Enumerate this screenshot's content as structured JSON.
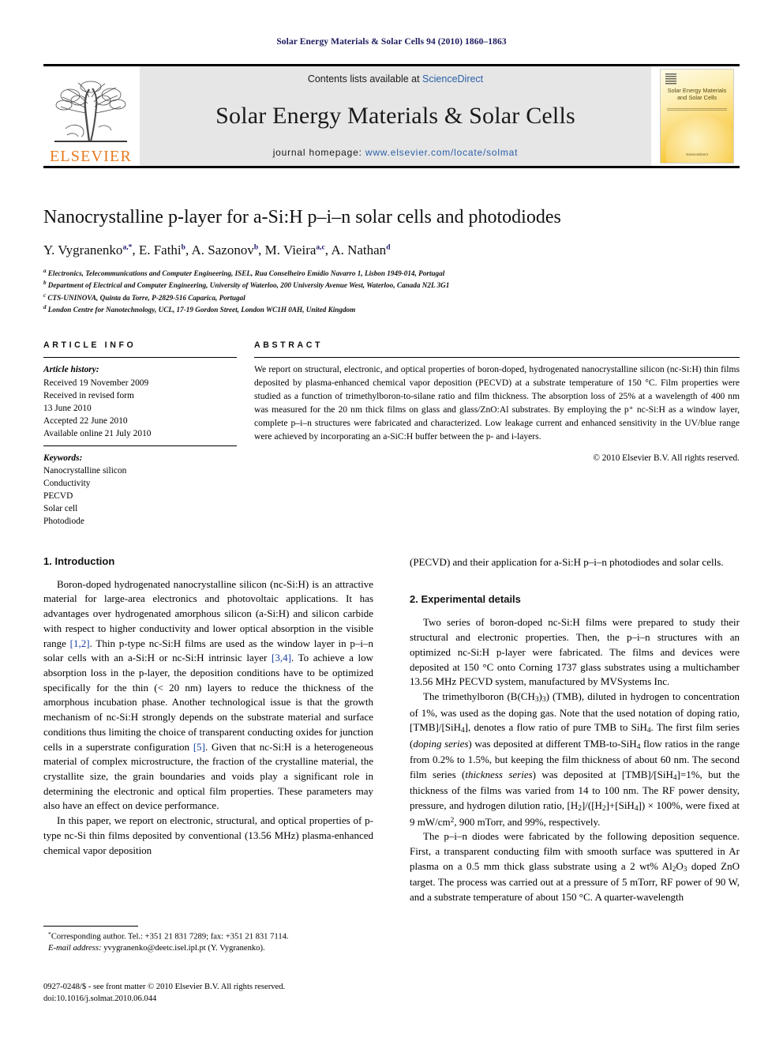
{
  "runhead": "Solar Energy Materials & Solar Cells 94 (2010) 1860–1863",
  "masthead": {
    "contents_prefix": "Contents lists available at ",
    "sciencedirect": "ScienceDirect",
    "journal_title": "Solar Energy Materials & Solar Cells",
    "homepage_prefix": "journal homepage: ",
    "homepage_url": "www.elsevier.com/locate/solmat",
    "publisher_logo_text": "ELSEVIER",
    "cover": {
      "line1": "Solar Energy Materials",
      "line2": "and Solar Cells",
      "footer": "ScienceDirect"
    },
    "link_color": "#2b5fa8",
    "band_bg": "#e6e6e6",
    "logo_color": "#E8791E"
  },
  "article": {
    "title": "Nanocrystalline p-layer for a-Si:H p–i–n solar cells and photodiodes",
    "authors": [
      {
        "name": "Y. Vygranenko",
        "marks": "a,*"
      },
      {
        "name": "E. Fathi",
        "marks": "b"
      },
      {
        "name": "A. Sazonov",
        "marks": "b"
      },
      {
        "name": "M. Vieira",
        "marks": "a,c"
      },
      {
        "name": "A. Nathan",
        "marks": "d"
      }
    ],
    "affiliations": [
      {
        "mark": "a",
        "text": "Electronics, Telecommunications and Computer Engineering, ISEL, Rua Conselheiro Emídio Navarro 1, Lisbon 1949-014, Portugal"
      },
      {
        "mark": "b",
        "text": "Department of Electrical and Computer Engineering, University of Waterloo, 200 University Avenue West, Waterloo, Canada N2L 3G1"
      },
      {
        "mark": "c",
        "text": "CTS-UNINOVA, Quinta da Torre, P-2829-516 Caparica, Portugal"
      },
      {
        "mark": "d",
        "text": "London Centre for Nanotechnology, UCL, 17-19 Gordon Street, London WC1H 0AH, United Kingdom"
      }
    ]
  },
  "info": {
    "heading": "ARTICLE INFO",
    "history_label": "Article history:",
    "history": [
      "Received 19 November 2009",
      "Received in revised form",
      "13 June 2010",
      "Accepted 22 June 2010",
      "Available online 21 July 2010"
    ],
    "keywords_label": "Keywords:",
    "keywords": [
      "Nanocrystalline silicon",
      "Conductivity",
      "PECVD",
      "Solar cell",
      "Photodiode"
    ]
  },
  "abstract": {
    "heading": "ABSTRACT",
    "text": "We report on structural, electronic, and optical properties of boron-doped, hydrogenated nanocrystalline silicon (nc-Si:H) thin films deposited by plasma-enhanced chemical vapor deposition (PECVD) at a substrate temperature of 150 °C. Film properties were studied as a function of trimethylboron-to-silane ratio and film thickness. The absorption loss of 25% at a wavelength of 400 nm was measured for the 20 nm thick films on glass and glass/ZnO:Al substrates. By employing the p⁺ nc-Si:H as a window layer, complete p–i–n structures were fabricated and characterized. Low leakage current and enhanced sensitivity in the UV/blue range were achieved by incorporating an a-SiC:H buffer between the p- and i-layers.",
    "copyright": "© 2010 Elsevier B.V. All rights reserved."
  },
  "sections": {
    "intro_heading": "1. Introduction",
    "intro_p1_a": "Boron-doped hydrogenated nanocrystalline silicon (nc-Si:H) is an attractive material for large-area electronics and photovoltaic applications. It has advantages over hydrogenated amorphous silicon (a-Si:H) and silicon carbide with respect to higher conductivity and lower optical absorption in the visible range ",
    "ref_12": "[1,2]",
    "intro_p1_b": ". Thin p-type nc-Si:H films are used as the window layer in p–i–n solar cells with an a-Si:H or nc-Si:H intrinsic layer ",
    "ref_34": "[3,4]",
    "intro_p1_c": ". To achieve a low absorption loss in the p-layer, the deposition conditions have to be optimized specifically for the thin (< 20 nm) layers to reduce the thickness of the amorphous incubation phase. Another technological issue is that the growth mechanism of nc-Si:H strongly depends on the substrate material and surface conditions thus limiting the choice of transparent conducting oxides for junction cells in a superstrate configuration ",
    "ref_5": "[5]",
    "intro_p1_d": ". Given that nc-Si:H is a heterogeneous material of complex microstructure, the fraction of the crystalline material, the crystallite size, the grain boundaries and voids play a significant role in determining the electronic and optical film properties. These parameters may also have an effect on device performance.",
    "intro_p2_left": "In this paper, we report on electronic, structural, and optical properties of p-type nc-Si thin films deposited by conventional (13.56 MHz) plasma-enhanced chemical vapor deposition",
    "intro_p2_right": "(PECVD) and their application for a-Si:H p–i–n photodiodes and solar cells.",
    "exp_heading": "2. Experimental details",
    "exp_p1": "Two series of boron-doped nc-Si:H films were prepared to study their structural and electronic properties. Then, the p–i–n structures with an optimized nc-Si:H p-layer were fabricated. The films and devices were deposited at 150 °C onto Corning 1737 glass substrates using a multichamber 13.56 MHz PECVD system, manufactured by MVSystems Inc.",
    "exp_p2_parts": {
      "a": "The trimethylboron (B(CH",
      "b": "3",
      "c": ")",
      "d": "3",
      "e": ") (TMB), diluted in hydrogen to concentration of 1%, was used as the doping gas. Note that the used notation of doping ratio, [TMB]/[SiH",
      "f": "4",
      "g": "], denotes a flow ratio of pure TMB to SiH",
      "h": "4",
      "i": ". The first film series (",
      "j": "doping series",
      "k": ") was deposited at different TMB-to-SiH",
      "l": "4",
      "m": " flow ratios in the range from 0.2% to 1.5%, but keeping the film thickness of about 60 nm. The second film series (",
      "n": "thickness series",
      "o": ") was deposited at [TMB]/[SiH",
      "p": "4",
      "q": "]=1%, but the thickness of the films was varied from 14 to 100 nm. The RF power density, pressure, and hydrogen dilution ratio,  [H",
      "r": "2",
      "s": "]/([H",
      "t": "2",
      "u": "]+[SiH",
      "v": "4",
      "w": "]) × 100%,  were  fixed  at  9 mW/cm",
      "x": "2",
      "y": ", 900 mTorr, and 99%, respectively."
    },
    "exp_p3_parts": {
      "a": "The p–i–n diodes were fabricated by the following deposition sequence. First, a transparent conducting film with smooth surface was sputtered in Ar plasma on a 0.5 mm thick glass substrate using a 2 wt% Al",
      "b": "2",
      "c": "O",
      "d": "3",
      "e": " doped ZnO target. The process was carried out at a pressure of 5 mTorr, RF power of 90 W, and a substrate temperature of about 150 °C. A quarter-wavelength"
    }
  },
  "footnotes": {
    "corresponding_mark": "*",
    "corresponding": "Corresponding author. Tel.: +351 21 831 7289; fax: +351 21 831 7114.",
    "email_label": "E-mail address:",
    "email": "yvygranenko@deetc.isel.ipl.pt (Y. Vygranenko).",
    "issn_line": "0927-0248/$ - see front matter © 2010 Elsevier B.V. All rights reserved.",
    "doi_line": "doi:10.1016/j.solmat.2010.06.044"
  }
}
